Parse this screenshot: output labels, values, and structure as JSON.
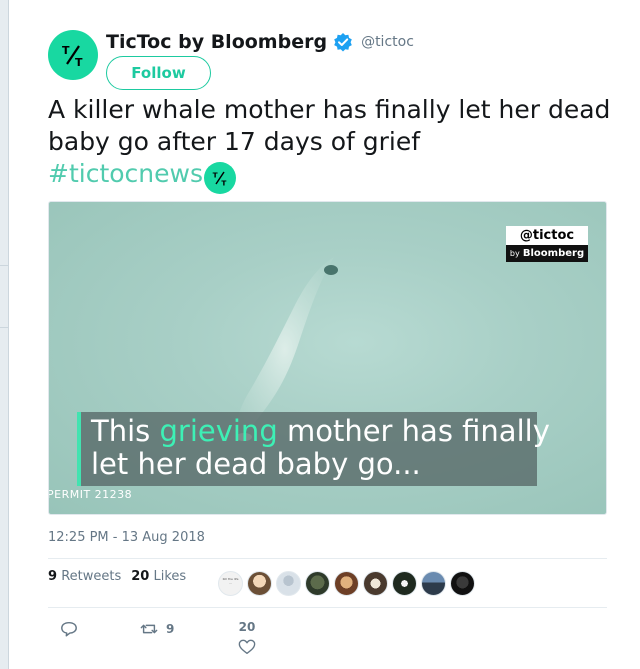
{
  "tweet": {
    "display_name": "TicToc by Bloomberg",
    "handle": "@tictoc",
    "follow_label": "Follow",
    "text": "A killer whale mother has finally let her dead baby go after 17 days of grief",
    "hashtag": "#tictocnews",
    "timestamp": "12:25 PM - 13 Aug 2018"
  },
  "media": {
    "watermark_handle": "@tictoc",
    "watermark_by": "by",
    "watermark_brand": "Bloomberg",
    "caption_line1_pre": "This ",
    "caption_line1_highlight": "grieving",
    "caption_line1_post": " mother has finally",
    "caption_line2": "let her dead baby go...",
    "permit": "PERMIT 21238"
  },
  "stats": {
    "retweets_count": "9",
    "retweets_label": "Retweets",
    "likes_count": "20",
    "likes_label": "Likes"
  },
  "actions": {
    "retweet_count": "9",
    "like_count": "20"
  },
  "colors": {
    "brand_green": "#18d8a1",
    "hashtag": "#51cbae",
    "verified": "#1da1f2"
  }
}
